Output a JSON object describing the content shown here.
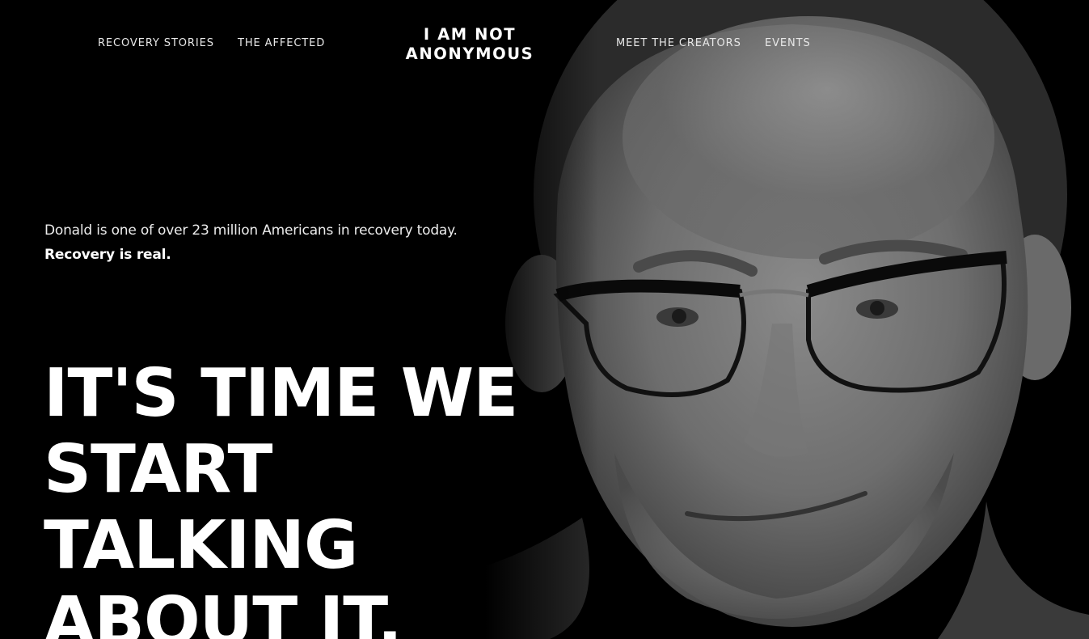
{
  "nav": {
    "left_items": [
      {
        "label": "RECOVERY STORIES"
      },
      {
        "label": "THE AFFECTED"
      }
    ],
    "right_items": [
      {
        "label": "MEET THE CREATORS"
      },
      {
        "label": "EVENTS"
      }
    ]
  },
  "logo": {
    "line1": "I AM NOT",
    "line2": "ANONYMOUS"
  },
  "hero": {
    "intro_text": "Donald is one of over 23 million Americans in recovery today.",
    "intro_bold": "Recovery is real.",
    "headline_lines": [
      "IT'S TIME WE",
      "START",
      "TALKING",
      "ABOUT IT."
    ],
    "portrait_subject": "man-with-glasses-portrait"
  },
  "colors": {
    "background": "#000000",
    "text": "#ffffff",
    "nav_text": "#e8e8e8"
  }
}
